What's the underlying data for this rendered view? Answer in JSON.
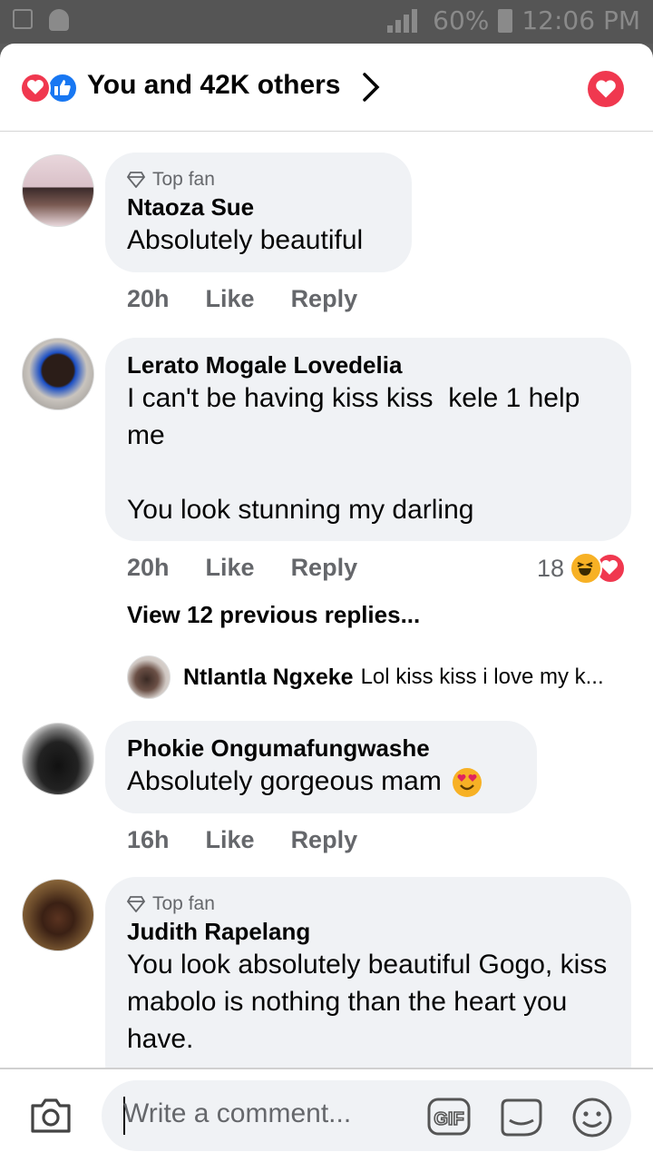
{
  "status_bar": {
    "battery": "60%",
    "time": "12:06 PM"
  },
  "header": {
    "title": "You and 42K others"
  },
  "comments": [
    {
      "top_fan": "Top fan",
      "author": "Ntaoza Sue",
      "text": "Absolutely beautiful",
      "time": "20h",
      "like": "Like",
      "reply": "Reply"
    },
    {
      "author": "Lerato Mogale Lovedelia",
      "text": "I can't be having kiss kiss  kele 1 help me\n\nYou look stunning my darling",
      "time": "20h",
      "like": "Like",
      "reply": "Reply",
      "reaction_count": "18",
      "view_previous": "View 12 previous replies...",
      "reply_preview": {
        "author": "Ntlantla Ngxeke",
        "text": "Lol kiss kiss i love my k..."
      }
    },
    {
      "author": "Phokie Ongumafungwashe",
      "text": "Absolutely gorgeous mam",
      "time": "16h",
      "like": "Like",
      "reply": "Reply"
    },
    {
      "top_fan": "Top fan",
      "author": "Judith Rapelang",
      "text": "You look absolutely beautiful Gogo, kiss mabolo is nothing than the heart you have."
    }
  ],
  "composer": {
    "placeholder": "Write a comment..."
  },
  "colors": {
    "love": "#f0384f",
    "like": "#1877f2",
    "bubble": "#f0f2f5",
    "meta": "#65676b"
  },
  "icons": [
    "camera-icon",
    "gif-icon",
    "sticker-icon",
    "emoji-icon",
    "chevron-right-icon",
    "diamond-icon"
  ]
}
